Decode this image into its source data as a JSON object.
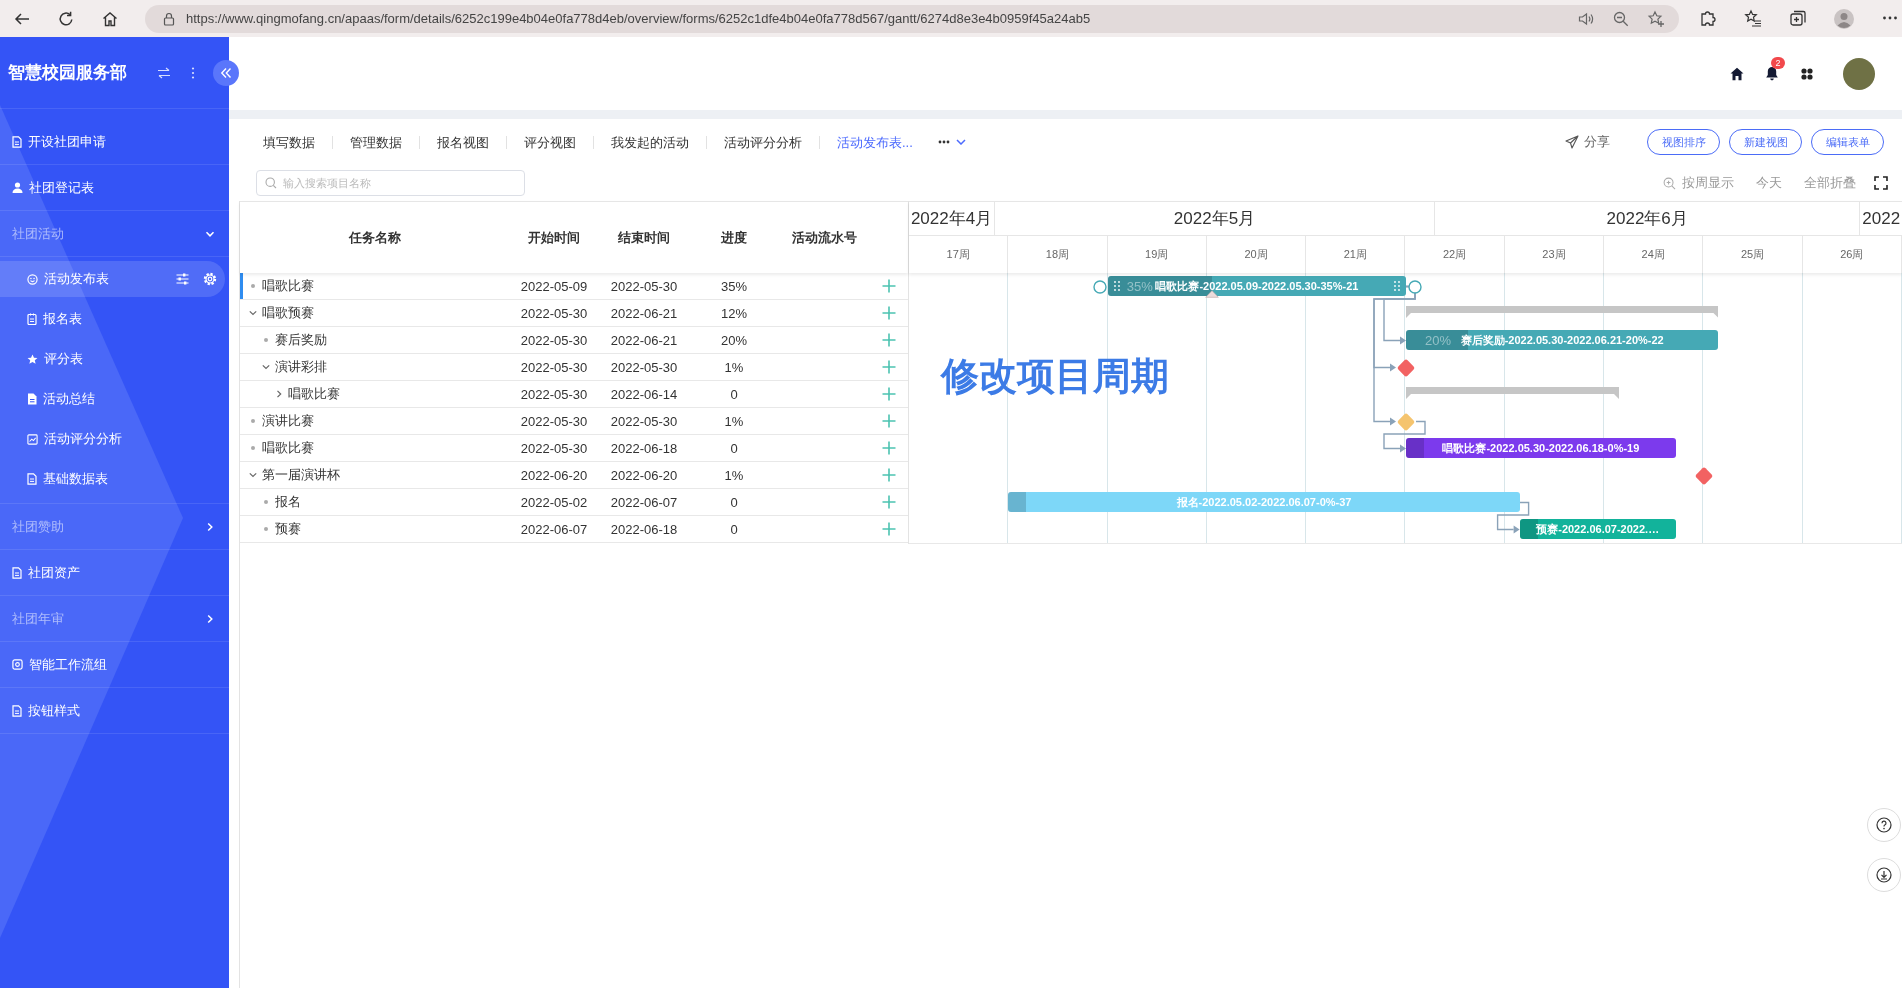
{
  "browser": {
    "url": "https://www.qingmofang.cn/apaas/form/details/6252c199e4b04e0fa778d4eb/overview/forms/6252c1dfe4b04e0fa778d567/gantt/6274d8e3e4b0959f45a24ab5"
  },
  "sidebar": {
    "title": "智慧校园服务部",
    "items": [
      {
        "kind": "link",
        "label": "开设社团申请",
        "selected": false
      },
      {
        "kind": "link",
        "label": "社团登记表",
        "selected": false
      },
      {
        "kind": "group",
        "label": "社团活动",
        "expanded": true,
        "children": [
          {
            "kind": "link",
            "label": "活动发布表",
            "selected": true
          },
          {
            "kind": "link",
            "label": "报名表",
            "selected": false
          },
          {
            "kind": "link",
            "label": "评分表",
            "selected": false
          },
          {
            "kind": "link",
            "label": "活动总结",
            "selected": false
          },
          {
            "kind": "link",
            "label": "活动评分分析",
            "selected": false
          },
          {
            "kind": "link",
            "label": "基础数据表",
            "selected": false
          }
        ]
      },
      {
        "kind": "group",
        "label": "社团赞助",
        "expanded": false
      },
      {
        "kind": "link",
        "label": "社团资产",
        "selected": false
      },
      {
        "kind": "group",
        "label": "社团年审",
        "expanded": false
      },
      {
        "kind": "link",
        "label": "智能工作流组",
        "selected": false
      },
      {
        "kind": "link",
        "label": "按钮样式",
        "selected": false
      }
    ]
  },
  "header": {
    "notification_count": "2"
  },
  "view_tabs": [
    {
      "label": "填写数据",
      "selected": false
    },
    {
      "label": "管理数据",
      "selected": false
    },
    {
      "label": "报名视图",
      "selected": false
    },
    {
      "label": "评分视图",
      "selected": false
    },
    {
      "label": "我发起的活动",
      "selected": false
    },
    {
      "label": "活动评分分析",
      "selected": false
    },
    {
      "label": "活动发布表...",
      "selected": true
    }
  ],
  "share": {
    "label": "分享"
  },
  "view_buttons": [
    "视图排序",
    "新建视图",
    "编辑表单"
  ],
  "search": {
    "placeholder": "输入搜索项目名称"
  },
  "gantt_toolbar": [
    "按周显示",
    "今天",
    "全部折叠"
  ],
  "table": {
    "columns": [
      "任务名称",
      "开始时间",
      "结束时间",
      "进度",
      "活动流水号"
    ],
    "rows": [
      {
        "name": "唱歌比赛",
        "start": "2022-05-09",
        "end": "2022-05-30",
        "progress": "35%",
        "selected": true,
        "kind": "task",
        "bar": {
          "kind": "task",
          "color": "#45a9b5",
          "level": 0.35,
          "label": "唱歌比赛-2022.05.09-2022.05.30-35%-21",
          "progress_label": "35%",
          "link_out": true
        }
      },
      {
        "name": "唱歌预赛",
        "start": "2022-05-30",
        "end": "2022-06-21",
        "progress": "12%",
        "selected": false,
        "kind": "group",
        "expanded": true,
        "bar": {
          "kind": "summary"
        },
        "children": [
          {
            "name": "赛后奖励",
            "start": "2022-05-30",
            "end": "2022-06-21",
            "progress": "20%",
            "selected": false,
            "kind": "task",
            "bar": {
              "kind": "task",
              "color": "#45a9b5",
              "level": 0.2,
              "label": "赛后奖励-2022.05.30-2022.06.21-20%-22",
              "progress_label": "20%",
              "link_in": true
            }
          },
          {
            "name": "演讲彩排",
            "start": "2022-05-30",
            "end": "2022-05-30",
            "progress": "1%",
            "selected": false,
            "kind": "group",
            "expanded": true,
            "bar": {
              "kind": "milestone",
              "color": "#f26262",
              "link_in": true
            },
            "children": [
              {
                "name": "唱歌比赛",
                "start": "2022-05-30",
                "end": "2022-06-14",
                "progress": "0",
                "selected": false,
                "kind": "group",
                "expanded": false,
                "bar": {
                  "kind": "summary"
                }
              }
            ]
          }
        ]
      },
      {
        "name": "演讲比赛",
        "start": "2022-05-30",
        "end": "2022-05-30",
        "progress": "1%",
        "selected": false,
        "kind": "task",
        "bar": {
          "kind": "milestone",
          "color": "#f5c46e",
          "link_in": true,
          "link_out": true
        }
      },
      {
        "name": "唱歌比赛",
        "start": "2022-05-30",
        "end": "2022-06-18",
        "progress": "0",
        "selected": false,
        "kind": "task",
        "bar": {
          "kind": "task",
          "color": "#7c3aed",
          "level": 0,
          "label": "唱歌比赛-2022.05.30-2022.06.18-0%-19",
          "link_in": true
        }
      },
      {
        "name": "第一届演讲杯",
        "start": "2022-06-20",
        "end": "2022-06-20",
        "progress": "1%",
        "selected": false,
        "kind": "group",
        "expanded": true,
        "bar": {
          "kind": "milestone",
          "color": "#f26262"
        },
        "children": [
          {
            "name": "报名",
            "start": "2022-05-02",
            "end": "2022-06-07",
            "progress": "0",
            "selected": false,
            "kind": "task",
            "bar": {
              "kind": "task",
              "color": "#7dd7f8",
              "level": 0,
              "label": "报名-2022.05.02-2022.06.07-0%-37",
              "link_out": true
            }
          },
          {
            "name": "预赛",
            "start": "2022-06-07",
            "end": "2022-06-18",
            "progress": "0",
            "selected": false,
            "kind": "task",
            "bar": {
              "kind": "task",
              "color": "#12b39b",
              "level": 0,
              "label": "预赛-2022.06.07-2022.…",
              "link_in": true
            }
          }
        ]
      }
    ]
  },
  "gantt": {
    "months": [
      "2022年4月",
      "2022年5月",
      "2022年6月",
      "2022"
    ],
    "weeks": [
      "17周",
      "18周",
      "19周",
      "20周",
      "21周",
      "22周",
      "23周",
      "24周",
      "25周",
      "26周"
    ],
    "caption": "修改项目周期"
  }
}
